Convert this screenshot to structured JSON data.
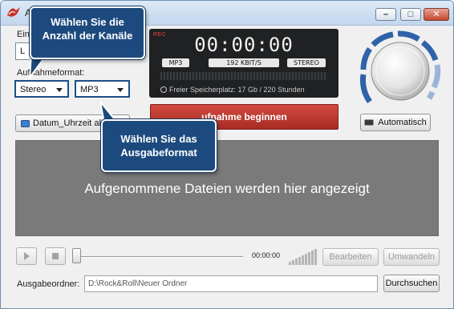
{
  "window": {
    "title": "A",
    "buttons": {
      "minimize": "–",
      "maximize": "□",
      "close": "✕"
    },
    "icon": "app-logo-icon"
  },
  "left": {
    "device_label": "Ein",
    "device_value": "L",
    "format_label": "Aufnahmeformat:",
    "channels": "Stereo",
    "output_format": "MP3",
    "schedule_button": "Datum_Uhrzeit al"
  },
  "display": {
    "rec_indicator": "REC",
    "timer": "00:00:00",
    "format": "MP3",
    "bitrate": "192 KBIT/S",
    "channels": "STEREO",
    "free_space": "Freier Speicherplatz: 17 Gb / 220 Stunden"
  },
  "record_button": "ufnahme beginnen",
  "auto_button": "Automatisch",
  "dropzone_text": "Aufgenommene Dateien werden hier angezeigt",
  "player": {
    "time": "00:00:00",
    "edit_button": "Bearbeiten",
    "convert_button": "Umwandeln"
  },
  "output": {
    "label": "Ausgabeordner:",
    "path": "D:\\Rock&Roll\\Neuer Ordner",
    "browse_button": "Durchsuchen"
  },
  "callouts": {
    "channels_line1": "Wählen Sie die",
    "channels_line2": "Anzahl der Kanäle",
    "format_line1": "Wählen Sie das",
    "format_line2": "Ausgabeformat"
  },
  "colors": {
    "callout_bg": "#1d4a7e",
    "record_red": "#c0392f",
    "display_bg": "#1f2123",
    "knob_arc": "#2f63a8"
  }
}
